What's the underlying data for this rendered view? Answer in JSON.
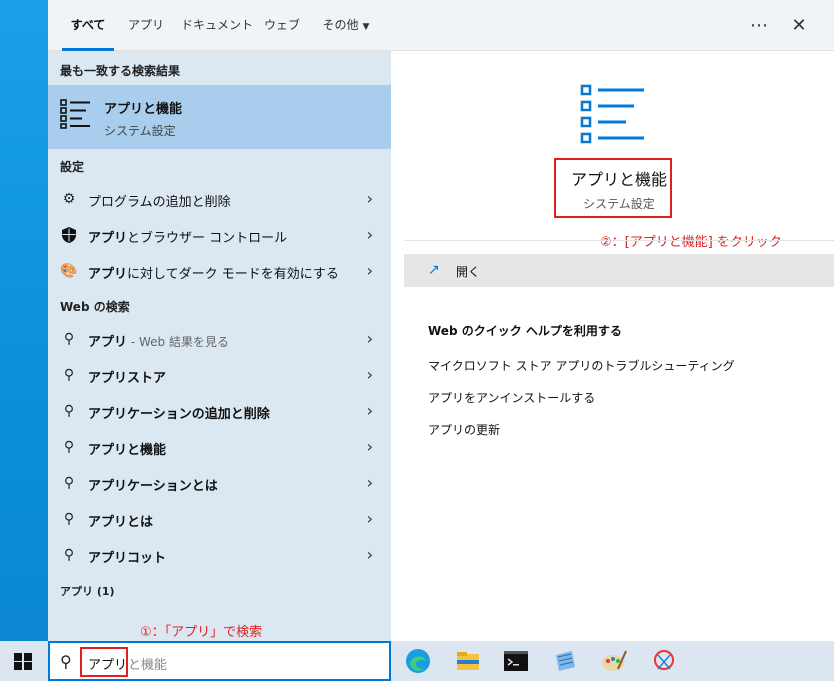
{
  "tabs": {
    "items": [
      "すべて",
      "アプリ",
      "ドキュメント",
      "ウェブ",
      "その他"
    ],
    "more_icon": "ellipsis-icon",
    "close_icon": "close-icon"
  },
  "left": {
    "best_match_heading": "最も一致する検索結果",
    "best": {
      "title": "アプリと機能",
      "subtitle": "システム設定",
      "icon": "list-settings-icon"
    },
    "settings_heading": "設定",
    "settings_items": [
      {
        "bold": "",
        "rest": "プログラムの追加と削除",
        "icon": "gear-icon"
      },
      {
        "bold": "アプリ",
        "rest": "とブラウザー コントロール",
        "icon": "shield-icon"
      },
      {
        "bold": "アプリ",
        "rest": "に対してダーク モードを有効にする",
        "icon": "palette-icon"
      }
    ],
    "web_heading": "Web の検索",
    "web_items": [
      {
        "bold": "アプリ",
        "dim": " - Web 結果を見る",
        "icon": "search-icon"
      },
      {
        "bold": "アプリストア",
        "dim": "",
        "icon": "search-icon"
      },
      {
        "bold": "アプリケーションの追加と削除",
        "dim": "",
        "icon": "search-icon"
      },
      {
        "bold": "アプリと機能",
        "dim": "",
        "icon": "search-icon"
      },
      {
        "bold": "アプリケーションとは",
        "dim": "",
        "icon": "search-icon"
      },
      {
        "bold": "アプリとは",
        "dim": "",
        "icon": "search-icon"
      },
      {
        "bold": "アプリコット",
        "dim": "",
        "icon": "search-icon"
      }
    ],
    "apps_heading": "アプリ (1)"
  },
  "right": {
    "app_title": "アプリと機能",
    "app_subtitle": "システム設定",
    "open_label": "開く",
    "help_heading": "Web のクイック ヘルプを利用する",
    "help_links": [
      "マイクロソフト ストア アプリのトラブルシューティング",
      "アプリをアンインストールする",
      "アプリの更新"
    ]
  },
  "annotations": {
    "step1": "①：「アプリ」で検索",
    "step2": "②：[アプリと機能] をクリック",
    "color": "#e02020"
  },
  "taskbar": {
    "search_typed": "アプリ",
    "search_suggestion": "と機能",
    "apps": [
      "edge-icon",
      "file-explorer-icon",
      "command-prompt-icon",
      "notepad-icon",
      "paint-icon",
      "snipping-tool-icon"
    ]
  },
  "colors": {
    "accent": "#0078d7",
    "selection": "#a9cdec",
    "left_bg": "#dbe8f2"
  }
}
